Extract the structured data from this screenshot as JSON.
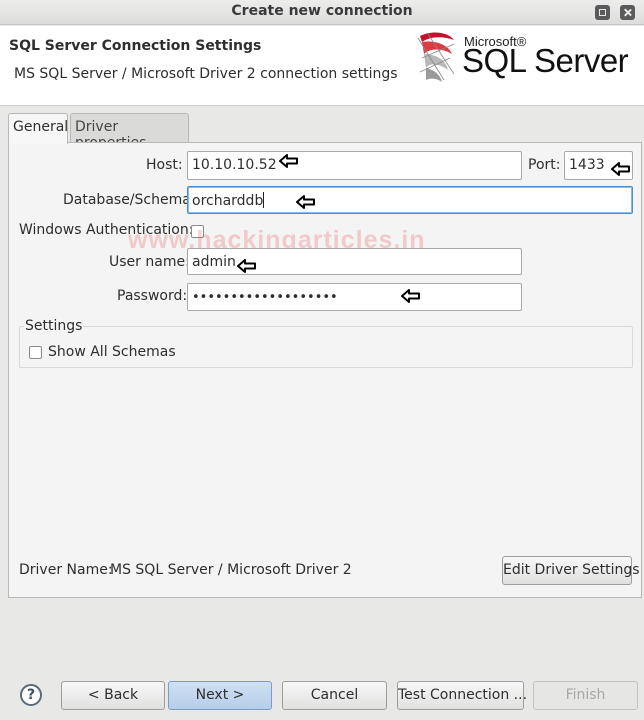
{
  "window": {
    "title": "Create new connection"
  },
  "header": {
    "title": "SQL Server Connection Settings",
    "subtitle": "MS SQL Server / Microsoft Driver 2 connection settings",
    "logo_top": "Microsoft®",
    "logo_main": "SQL Server"
  },
  "tabs": [
    {
      "label": "General"
    },
    {
      "label": "Driver properties"
    }
  ],
  "form": {
    "host_label": "Host:",
    "host_value": "10.10.10.52",
    "port_label": "Port:",
    "port_value": "1433",
    "database_label": "Database/Schema:",
    "database_value": "orcharddb",
    "windows_auth_label": "Windows Authentication:",
    "username_label": "User name:",
    "username_value": "admin",
    "password_label": "Password:",
    "password_value": "•••••••••••••••••••"
  },
  "settings": {
    "legend": "Settings",
    "show_all_schemas_label": "Show All Schemas"
  },
  "driver": {
    "label": "Driver Name:",
    "value": "MS SQL Server / Microsoft Driver 2",
    "edit_button": "Edit Driver Settings"
  },
  "watermark": "www.hackingarticles.in",
  "buttons": {
    "help": "?",
    "back": "< Back",
    "next": "Next >",
    "cancel": "Cancel",
    "test": "Test Connection ...",
    "finish": "Finish"
  },
  "icons": {
    "arrow": "left-arrow-annotation-icon",
    "logo": "sql-server-logo"
  }
}
